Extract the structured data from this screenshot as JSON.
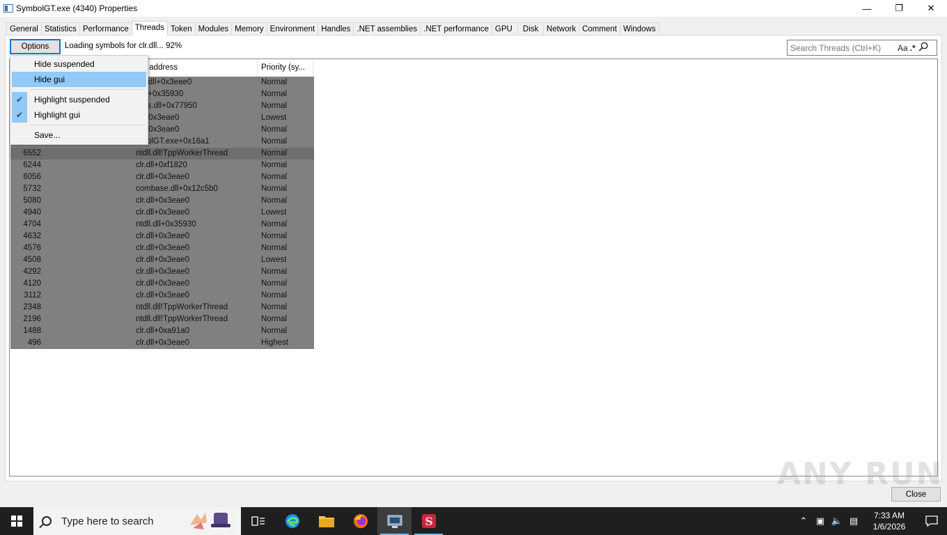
{
  "window": {
    "title": "SymbolGT.exe (4340) Properties",
    "minimize_icon": "minimize-icon",
    "restore_icon": "restore-icon",
    "close_icon": "close-icon"
  },
  "tabs": [
    {
      "label": "General"
    },
    {
      "label": "Statistics"
    },
    {
      "label": "Performance"
    },
    {
      "label": "Threads",
      "active": true
    },
    {
      "label": "Token"
    },
    {
      "label": "Modules"
    },
    {
      "label": "Memory"
    },
    {
      "label": "Environment"
    },
    {
      "label": "Handles"
    },
    {
      "label": ".NET assemblies"
    },
    {
      "label": ".NET performance"
    },
    {
      "label": "GPU"
    },
    {
      "label": "Disk"
    },
    {
      "label": "Network"
    },
    {
      "label": "Comment"
    },
    {
      "label": "Windows"
    }
  ],
  "toolbar": {
    "options_label": "Options",
    "status": "Loading symbols for clr.dll... 92%",
    "search_placeholder": "Search Threads (Ctrl+K)",
    "case_label": "Aa",
    "regex_label": ".*"
  },
  "columns": {
    "start_address": "rt address",
    "priority": "Priority (sy..."
  },
  "threads": [
    {
      "tid": "",
      "address": "tdll.dll+0x3eae0",
      "priority": "Normal"
    },
    {
      "tid": "",
      "address": "l.dll+0x35930",
      "priority": "Normal"
    },
    {
      "tid": "",
      "address": "Plus.dll+0x77950",
      "priority": "Normal"
    },
    {
      "tid": "",
      "address": "dll+0x3eae0",
      "priority": "Lowest"
    },
    {
      "tid": "",
      "address": "dll+0x3eae0",
      "priority": "Normal"
    },
    {
      "tid": "",
      "address": "mbolGT.exe+0x16a1",
      "priority": "Normal"
    },
    {
      "tid": "6552",
      "address": "ntdll.dll!TppWorkerThread",
      "priority": "Normal"
    },
    {
      "tid": "6244",
      "address": "clr.dll+0xf1820",
      "priority": "Normal"
    },
    {
      "tid": "6056",
      "address": "clr.dll+0x3eae0",
      "priority": "Normal"
    },
    {
      "tid": "5732",
      "address": "combase.dll+0x12c5b0",
      "priority": "Normal"
    },
    {
      "tid": "5080",
      "address": "clr.dll+0x3eae0",
      "priority": "Normal"
    },
    {
      "tid": "4940",
      "address": "clr.dll+0x3eae0",
      "priority": "Lowest"
    },
    {
      "tid": "4704",
      "address": "ntdll.dll+0x35930",
      "priority": "Normal"
    },
    {
      "tid": "4632",
      "address": "clr.dll+0x3eae0",
      "priority": "Normal"
    },
    {
      "tid": "4576",
      "address": "clr.dll+0x3eae0",
      "priority": "Normal"
    },
    {
      "tid": "4508",
      "address": "clr.dll+0x3eae0",
      "priority": "Lowest"
    },
    {
      "tid": "4292",
      "address": "clr.dll+0x3eae0",
      "priority": "Normal"
    },
    {
      "tid": "4120",
      "address": "clr.dll+0x3eae0",
      "priority": "Normal"
    },
    {
      "tid": "3112",
      "address": "clr.dll+0x3eae0",
      "priority": "Normal"
    },
    {
      "tid": "2348",
      "address": "ntdll.dll!TppWorkerThread",
      "priority": "Normal"
    },
    {
      "tid": "2196",
      "address": "ntdll.dll!TppWorkerThread",
      "priority": "Normal"
    },
    {
      "tid": "1488",
      "address": "clr.dll+0xa91a0",
      "priority": "Normal"
    },
    {
      "tid": "496",
      "address": "clr.dll+0x3eae0",
      "priority": "Highest"
    }
  ],
  "menu": {
    "hide_suspended": "Hide suspended",
    "hide_gui": "Hide gui",
    "highlight_suspended": "Highlight suspended",
    "highlight_gui": "Highlight gui",
    "save": "Save..."
  },
  "footer": {
    "close_label": "Close"
  },
  "watermark": "ANY RUN",
  "taskbar": {
    "search_placeholder": "Type here to search",
    "time": "7:33 AM",
    "date": "1/6/2026"
  },
  "colors": {
    "accent": "#0078d7",
    "menu_highlight": "#91c9f7",
    "thread_row_bg": "#808080",
    "taskbar_bg": "#1f1f1f"
  }
}
